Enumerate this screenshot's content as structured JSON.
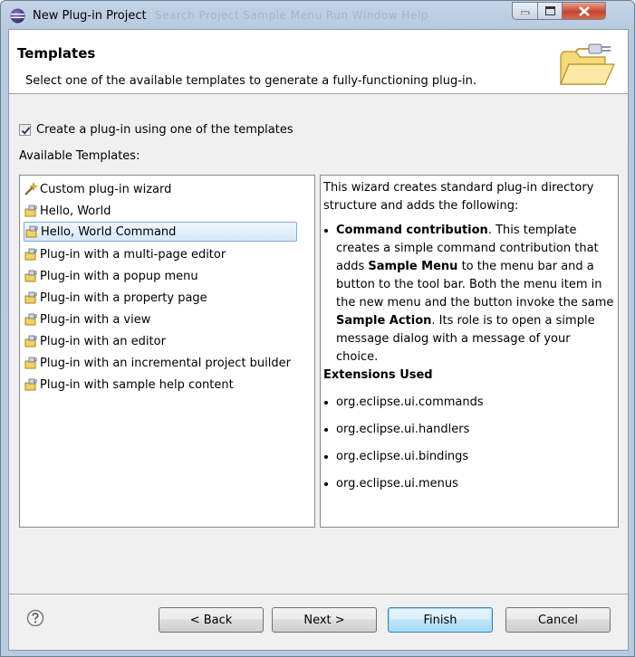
{
  "window": {
    "title": "New Plug-in Project",
    "background_menu": "Search  Project  Sample Menu  Run  Window  Help"
  },
  "banner": {
    "title": "Templates",
    "description": "Select one of the available templates to generate a fully-functioning plug-in.",
    "icon": "folder-plug-icon"
  },
  "checkbox": {
    "label": "Create a plug-in using one of the templates",
    "checked": true
  },
  "templates": {
    "label": "Available Templates:",
    "items": [
      {
        "label": "Custom plug-in wizard",
        "icon": "wand-icon"
      },
      {
        "label": "Hello, World",
        "icon": "plugin-template-icon"
      },
      {
        "label": "Hello, World Command",
        "icon": "plugin-template-icon",
        "selected": true
      },
      {
        "label": "Plug-in with a multi-page editor",
        "icon": "plugin-template-icon"
      },
      {
        "label": "Plug-in with a popup menu",
        "icon": "plugin-template-icon"
      },
      {
        "label": "Plug-in with a property page",
        "icon": "plugin-template-icon"
      },
      {
        "label": "Plug-in with a view",
        "icon": "plugin-template-icon"
      },
      {
        "label": "Plug-in with an editor",
        "icon": "plugin-template-icon"
      },
      {
        "label": "Plug-in with an incremental project builder",
        "icon": "plugin-template-icon"
      },
      {
        "label": "Plug-in with sample help content",
        "icon": "plugin-template-icon"
      }
    ]
  },
  "description": {
    "intro": "This wizard creates standard plug-in directory structure and adds the following:",
    "bullet_bold": "Command contribution",
    "bullet_t1": ". This template creates a simple command contribution that adds ",
    "bullet_b2": "Sample Menu",
    "bullet_t2": " to the menu bar and a button to the tool bar. Both the menu item in the new menu and the button invoke the same ",
    "bullet_b3": "Sample Action",
    "bullet_t3": ". Its role is to open a simple message dialog with a message of your choice.",
    "extensions_heading": "Extensions Used",
    "extensions": [
      "org.eclipse.ui.commands",
      "org.eclipse.ui.handlers",
      "org.eclipse.ui.bindings",
      "org.eclipse.ui.menus"
    ]
  },
  "buttons": {
    "back": "< Back",
    "next": "Next >",
    "finish": "Finish",
    "cancel": "Cancel"
  }
}
